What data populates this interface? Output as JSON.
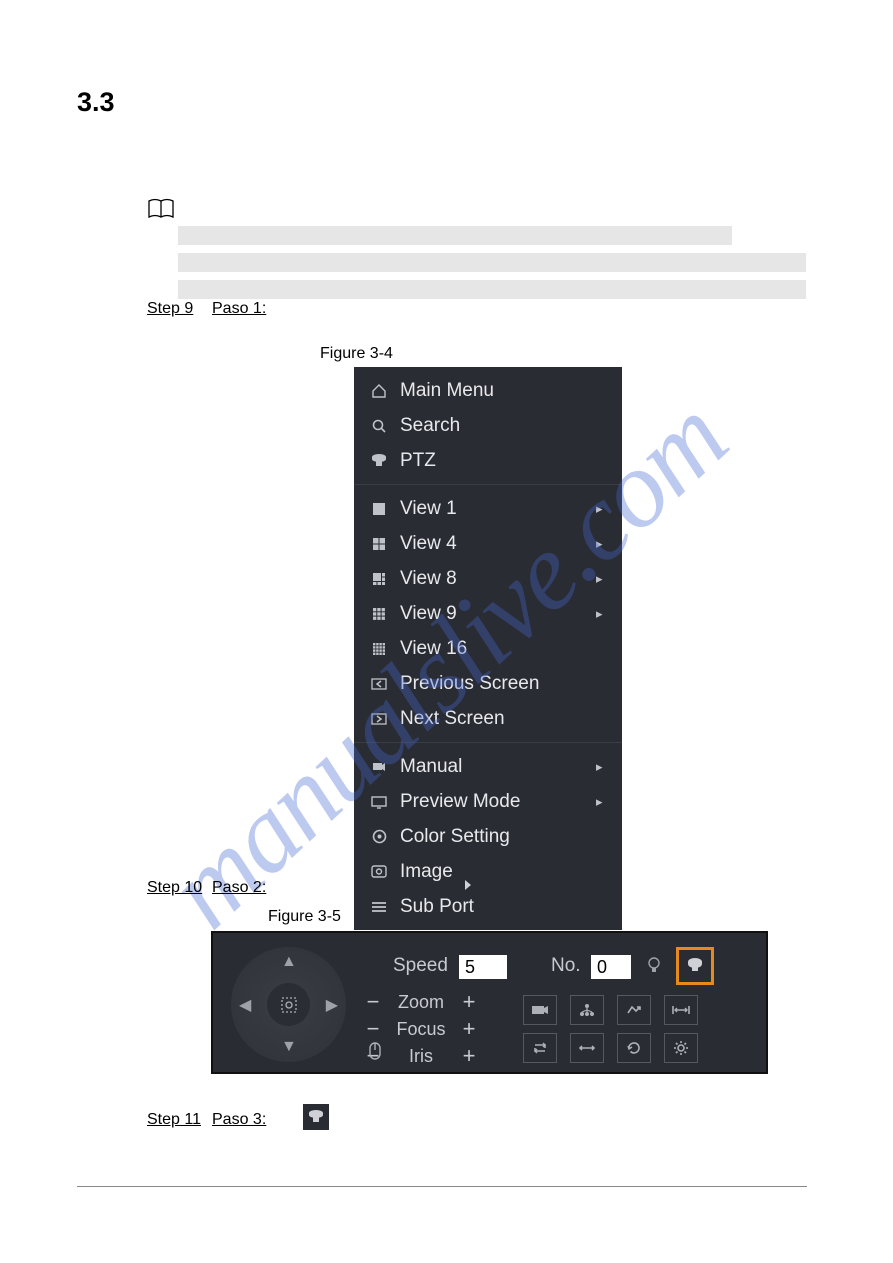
{
  "section_number": "3.3",
  "steps": {
    "s9": "Step 9",
    "p1": "Paso 1:",
    "s10": "Step 10",
    "p2": "Paso 2:",
    "s11": "Step 11",
    "p3": "Paso 3:"
  },
  "figures": {
    "f34": "Figure 3-4",
    "f35": "Figure 3-5"
  },
  "context_menu": {
    "group1": [
      {
        "icon": "home",
        "label": "Main Menu",
        "sub": false
      },
      {
        "icon": "search",
        "label": "Search",
        "sub": false
      },
      {
        "icon": "ptz",
        "label": "PTZ",
        "sub": false
      }
    ],
    "group2": [
      {
        "icon": "view1",
        "label": "View 1",
        "sub": true
      },
      {
        "icon": "view4",
        "label": "View 4",
        "sub": true
      },
      {
        "icon": "view8",
        "label": "View 8",
        "sub": true
      },
      {
        "icon": "view9",
        "label": "View 9",
        "sub": true
      },
      {
        "icon": "view16",
        "label": "View 16",
        "sub": false
      },
      {
        "icon": "prev",
        "label": "Previous Screen",
        "sub": false
      },
      {
        "icon": "next",
        "label": "Next Screen",
        "sub": false
      }
    ],
    "group3": [
      {
        "icon": "manual",
        "label": "Manual",
        "sub": true
      },
      {
        "icon": "preview",
        "label": "Preview Mode",
        "sub": true
      },
      {
        "icon": "color",
        "label": "Color Setting",
        "sub": false
      },
      {
        "icon": "image",
        "label": "Image",
        "sub": false
      },
      {
        "icon": "subport",
        "label": "Sub Port",
        "sub": false
      }
    ]
  },
  "ptz": {
    "speed_label": "Speed",
    "speed_value": "5",
    "no_label": "No.",
    "no_value": "0",
    "zoom": "Zoom",
    "focus": "Focus",
    "iris": "Iris"
  },
  "watermark": "manualslive.com"
}
